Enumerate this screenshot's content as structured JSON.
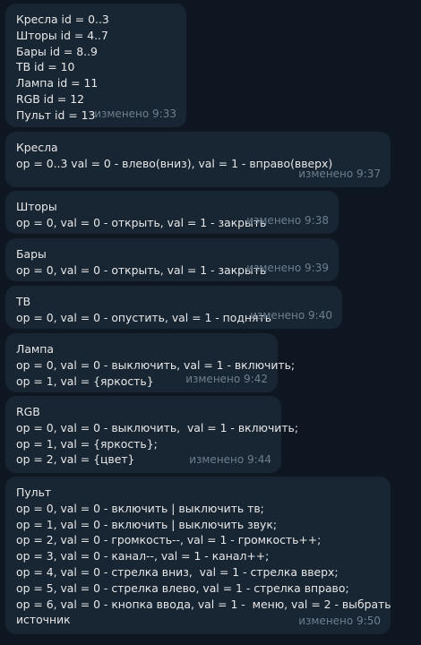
{
  "messages": [
    {
      "lines": [
        "Кресла id = 0..3",
        "Шторы id = 4..7",
        "Бары id = 8..9",
        "ТВ id = 10",
        "Лампа id = 11",
        "RGB id = 12",
        "Пульт id = 13"
      ],
      "meta": "изменено 9:33"
    },
    {
      "lines": [
        "Кресла",
        "op = 0..3 val = 0 - влево(вниз), val = 1 - вправо(вверх)"
      ],
      "meta": "изменено 9:37"
    },
    {
      "lines": [
        "Шторы",
        "op = 0, val = 0 - открыть, val = 1 - закрыть"
      ],
      "meta": "изменено 9:38"
    },
    {
      "lines": [
        "Бары",
        "op = 0, val = 0 - открыть, val = 1 - закрыть"
      ],
      "meta": "изменено 9:39"
    },
    {
      "lines": [
        "ТВ",
        "op = 0, val = 0 - опустить, val = 1 - поднять"
      ],
      "meta": "изменено 9:40"
    },
    {
      "lines": [
        "Лампа",
        "op = 0, val = 0 - выключить, val = 1 - включить;",
        "op = 1, val = {яркость}"
      ],
      "meta": "изменено 9:42"
    },
    {
      "lines": [
        "RGB",
        "op = 0, val = 0 - выключить,  val = 1 - включить;",
        "op = 1, val = {яркость};",
        "op = 2, val = {цвет}"
      ],
      "meta": "изменено 9:44"
    },
    {
      "lines": [
        "Пульт",
        "op = 0, val = 0 - включить | выключить тв;",
        "op = 1, val = 0 - включить | выключить звук;",
        "op = 2, val = 0 - громкость--, val = 1 - громкость++;",
        "op = 3, val = 0 - канал--, val = 1 - канал++;",
        "op = 4, val = 0 - стрелка вниз,  val = 1 - стрелка вверх;",
        "op = 5, val = 0 - стрелка влево, val = 1 - стрелка вправо;",
        "op = 6, val = 0 - кнопка ввода, val = 1 -  меню, val = 2 - выбрать",
        "источник"
      ],
      "meta": "изменено 9:50"
    }
  ]
}
